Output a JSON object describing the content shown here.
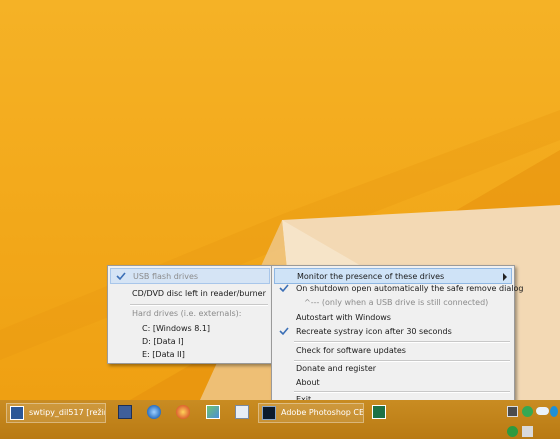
{
  "submenu": {
    "items": [
      {
        "label": "USB flash drives",
        "checked": true,
        "disabled": true
      },
      {
        "label": "CD/DVD disc left in reader/burner",
        "checked": false,
        "disabled": false
      },
      {
        "label": "Hard drives (i.e. externals):",
        "checked": false,
        "disabled": true
      },
      {
        "label": "C: [Windows 8.1]",
        "checked": false,
        "disabled": false
      },
      {
        "label": "D: [Data I]",
        "checked": false,
        "disabled": false
      },
      {
        "label": "E: [Data II]",
        "checked": false,
        "disabled": false
      }
    ]
  },
  "main_menu": {
    "items": [
      {
        "label": "Monitor the presence of these drives",
        "highlighted": true,
        "has_submenu": true
      },
      {
        "label": "On shutdown open automatically the safe remove dialog",
        "checked": true
      },
      {
        "label": "^--- (only when a USB drive is still connected)",
        "disabled": true
      },
      {
        "label": "Autostart with Windows",
        "checked": false
      },
      {
        "label": "Recreate systray icon after 30 seconds",
        "checked": true
      },
      {
        "label": "Check for software updates"
      },
      {
        "label": "Donate and register"
      },
      {
        "label": "About"
      },
      {
        "label": "Exit"
      }
    ]
  },
  "taskbar": {
    "word_button": "swtipy_dil517 [režim ...",
    "photoshop_button": "Adobe Photoshop CE",
    "icons": [
      "word-icon",
      "floppy-disk-icon",
      "network-globe-icon",
      "flowers-icon",
      "image-viewer-icon",
      "document-icon",
      "photoshop-icon",
      "excel-icon"
    ],
    "tray_icons": [
      "usb-drive-icon",
      "checkmark-icon",
      "cloud-icon",
      "skype-icon",
      "green-check-icon",
      "network-icon"
    ]
  },
  "colors": {
    "desktop": "#f3aa1c",
    "menu_background": "#f0f0f0",
    "highlight": "#cfe3f7",
    "taskbar": "#c28418"
  }
}
